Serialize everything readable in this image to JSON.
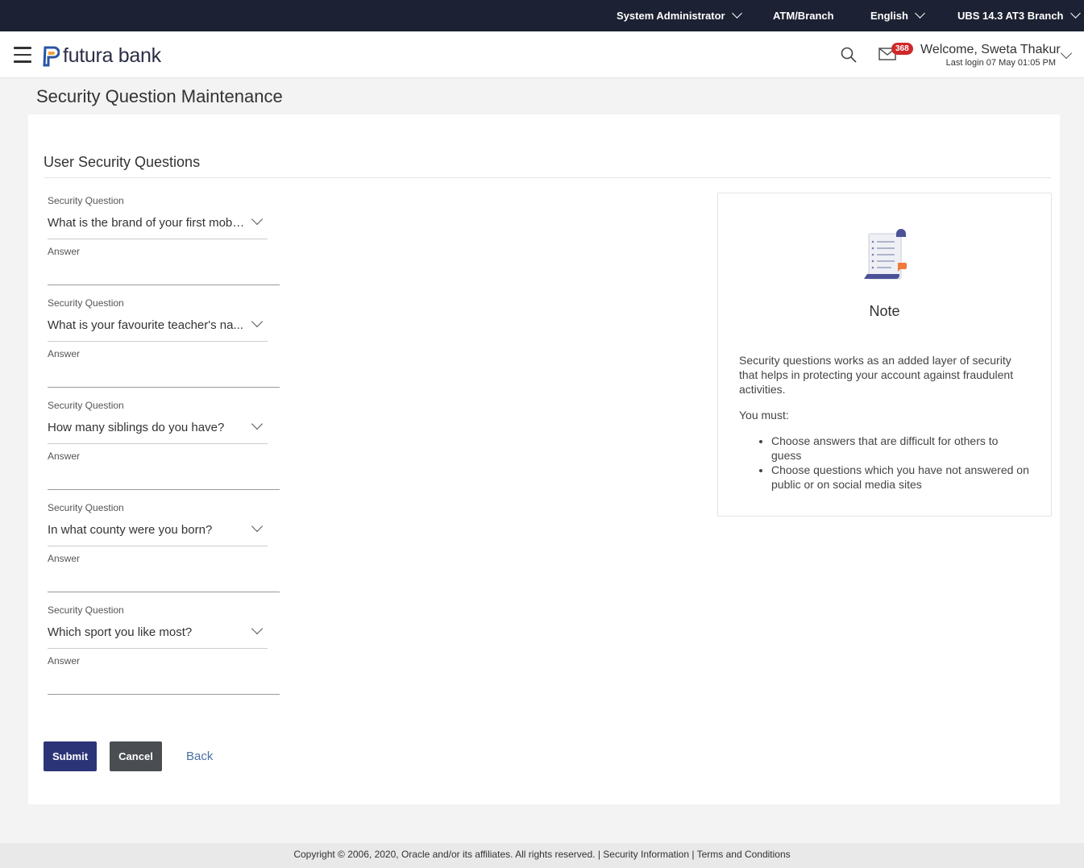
{
  "topbar": {
    "role": "System Administrator",
    "entity": "ATM/Branch",
    "language": "English",
    "branch": "UBS 14.3 AT3 Branch"
  },
  "header": {
    "brand": "futura bank",
    "notification_count": "368",
    "welcome": "Welcome, Sweta Thakur",
    "last_login": "Last login 07 May 01:05 PM"
  },
  "page": {
    "title": "Security Question Maintenance",
    "section_title": "User Security Questions"
  },
  "form": {
    "questions": [
      {
        "label": "Security Question",
        "value": "What is the brand of your first mobi...",
        "answer_label": "Answer",
        "answer_value": ""
      },
      {
        "label": "Security Question",
        "value": "What is your favourite teacher's na...",
        "answer_label": "Answer",
        "answer_value": ""
      },
      {
        "label": "Security Question",
        "value": "How many siblings do you have?",
        "answer_label": "Answer",
        "answer_value": ""
      },
      {
        "label": "Security Question",
        "value": "In what county were you born?",
        "answer_label": "Answer",
        "answer_value": ""
      },
      {
        "label": "Security Question",
        "value": "Which sport you like most?",
        "answer_label": "Answer",
        "answer_value": ""
      }
    ]
  },
  "actions": {
    "submit": "Submit",
    "cancel": "Cancel",
    "back": "Back"
  },
  "note": {
    "title": "Note",
    "intro": "Security questions works as an added layer of security that helps in protecting your account against fraudulent activities.",
    "must": "You must:",
    "points": [
      "Choose answers that are difficult for others to guess",
      "Choose questions which you have not answered on public or on social media sites"
    ]
  },
  "footer": {
    "copyright": "Copyright © 2006, 2020, Oracle and/or its affiliates. All rights reserved.",
    "sep": " | ",
    "security_info": "Security Information",
    "terms": "Terms and Conditions"
  },
  "colors": {
    "topbar": "#1c2233",
    "primary_button": "#2c3478",
    "secondary_button": "#4a4d52",
    "badge": "#d0282a",
    "link": "#4a6fa5"
  }
}
